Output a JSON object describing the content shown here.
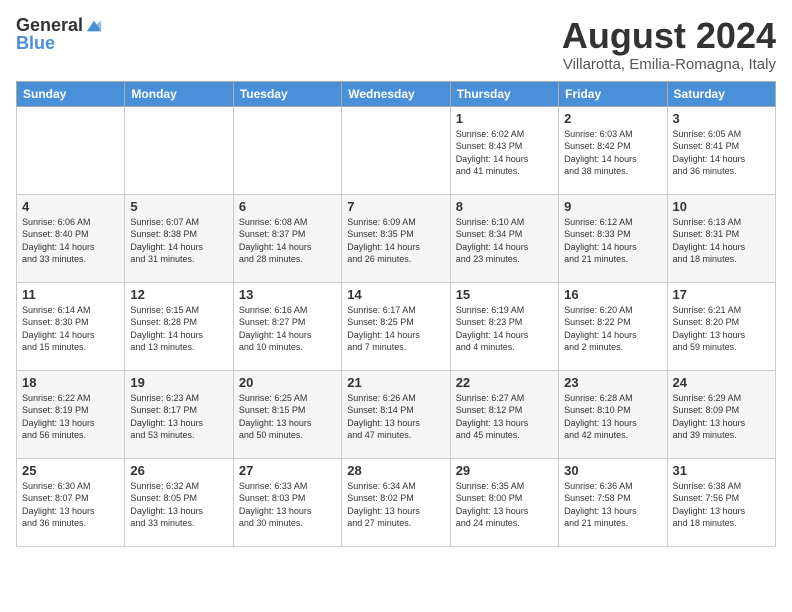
{
  "logo": {
    "text_general": "General",
    "text_blue": "Blue"
  },
  "title": "August 2024",
  "subtitle": "Villarotta, Emilia-Romagna, Italy",
  "weekdays": [
    "Sunday",
    "Monday",
    "Tuesday",
    "Wednesday",
    "Thursday",
    "Friday",
    "Saturday"
  ],
  "weeks": [
    [
      {
        "day": "",
        "info": ""
      },
      {
        "day": "",
        "info": ""
      },
      {
        "day": "",
        "info": ""
      },
      {
        "day": "",
        "info": ""
      },
      {
        "day": "1",
        "info": "Sunrise: 6:02 AM\nSunset: 8:43 PM\nDaylight: 14 hours\nand 41 minutes."
      },
      {
        "day": "2",
        "info": "Sunrise: 6:03 AM\nSunset: 8:42 PM\nDaylight: 14 hours\nand 38 minutes."
      },
      {
        "day": "3",
        "info": "Sunrise: 6:05 AM\nSunset: 8:41 PM\nDaylight: 14 hours\nand 36 minutes."
      }
    ],
    [
      {
        "day": "4",
        "info": "Sunrise: 6:06 AM\nSunset: 8:40 PM\nDaylight: 14 hours\nand 33 minutes."
      },
      {
        "day": "5",
        "info": "Sunrise: 6:07 AM\nSunset: 8:38 PM\nDaylight: 14 hours\nand 31 minutes."
      },
      {
        "day": "6",
        "info": "Sunrise: 6:08 AM\nSunset: 8:37 PM\nDaylight: 14 hours\nand 28 minutes."
      },
      {
        "day": "7",
        "info": "Sunrise: 6:09 AM\nSunset: 8:35 PM\nDaylight: 14 hours\nand 26 minutes."
      },
      {
        "day": "8",
        "info": "Sunrise: 6:10 AM\nSunset: 8:34 PM\nDaylight: 14 hours\nand 23 minutes."
      },
      {
        "day": "9",
        "info": "Sunrise: 6:12 AM\nSunset: 8:33 PM\nDaylight: 14 hours\nand 21 minutes."
      },
      {
        "day": "10",
        "info": "Sunrise: 6:13 AM\nSunset: 8:31 PM\nDaylight: 14 hours\nand 18 minutes."
      }
    ],
    [
      {
        "day": "11",
        "info": "Sunrise: 6:14 AM\nSunset: 8:30 PM\nDaylight: 14 hours\nand 15 minutes."
      },
      {
        "day": "12",
        "info": "Sunrise: 6:15 AM\nSunset: 8:28 PM\nDaylight: 14 hours\nand 13 minutes."
      },
      {
        "day": "13",
        "info": "Sunrise: 6:16 AM\nSunset: 8:27 PM\nDaylight: 14 hours\nand 10 minutes."
      },
      {
        "day": "14",
        "info": "Sunrise: 6:17 AM\nSunset: 8:25 PM\nDaylight: 14 hours\nand 7 minutes."
      },
      {
        "day": "15",
        "info": "Sunrise: 6:19 AM\nSunset: 8:23 PM\nDaylight: 14 hours\nand 4 minutes."
      },
      {
        "day": "16",
        "info": "Sunrise: 6:20 AM\nSunset: 8:22 PM\nDaylight: 14 hours\nand 2 minutes."
      },
      {
        "day": "17",
        "info": "Sunrise: 6:21 AM\nSunset: 8:20 PM\nDaylight: 13 hours\nand 59 minutes."
      }
    ],
    [
      {
        "day": "18",
        "info": "Sunrise: 6:22 AM\nSunset: 8:19 PM\nDaylight: 13 hours\nand 56 minutes."
      },
      {
        "day": "19",
        "info": "Sunrise: 6:23 AM\nSunset: 8:17 PM\nDaylight: 13 hours\nand 53 minutes."
      },
      {
        "day": "20",
        "info": "Sunrise: 6:25 AM\nSunset: 8:15 PM\nDaylight: 13 hours\nand 50 minutes."
      },
      {
        "day": "21",
        "info": "Sunrise: 6:26 AM\nSunset: 8:14 PM\nDaylight: 13 hours\nand 47 minutes."
      },
      {
        "day": "22",
        "info": "Sunrise: 6:27 AM\nSunset: 8:12 PM\nDaylight: 13 hours\nand 45 minutes."
      },
      {
        "day": "23",
        "info": "Sunrise: 6:28 AM\nSunset: 8:10 PM\nDaylight: 13 hours\nand 42 minutes."
      },
      {
        "day": "24",
        "info": "Sunrise: 6:29 AM\nSunset: 8:09 PM\nDaylight: 13 hours\nand 39 minutes."
      }
    ],
    [
      {
        "day": "25",
        "info": "Sunrise: 6:30 AM\nSunset: 8:07 PM\nDaylight: 13 hours\nand 36 minutes."
      },
      {
        "day": "26",
        "info": "Sunrise: 6:32 AM\nSunset: 8:05 PM\nDaylight: 13 hours\nand 33 minutes."
      },
      {
        "day": "27",
        "info": "Sunrise: 6:33 AM\nSunset: 8:03 PM\nDaylight: 13 hours\nand 30 minutes."
      },
      {
        "day": "28",
        "info": "Sunrise: 6:34 AM\nSunset: 8:02 PM\nDaylight: 13 hours\nand 27 minutes."
      },
      {
        "day": "29",
        "info": "Sunrise: 6:35 AM\nSunset: 8:00 PM\nDaylight: 13 hours\nand 24 minutes."
      },
      {
        "day": "30",
        "info": "Sunrise: 6:36 AM\nSunset: 7:58 PM\nDaylight: 13 hours\nand 21 minutes."
      },
      {
        "day": "31",
        "info": "Sunrise: 6:38 AM\nSunset: 7:56 PM\nDaylight: 13 hours\nand 18 minutes."
      }
    ]
  ]
}
